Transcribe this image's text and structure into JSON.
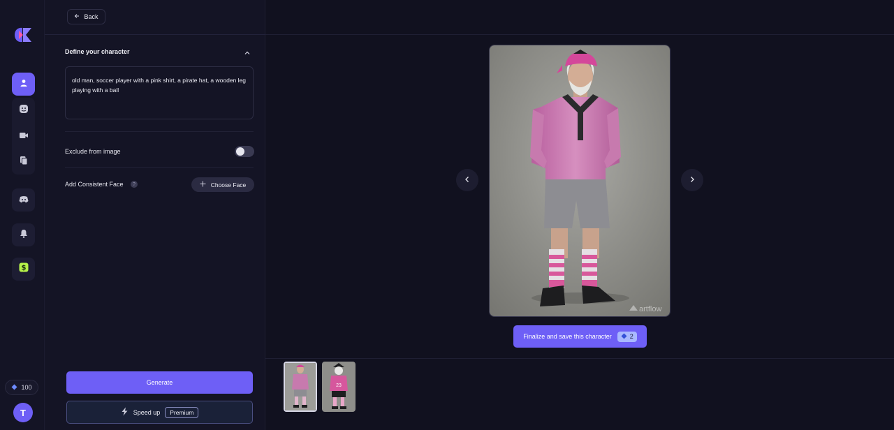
{
  "rail": {
    "items": [
      {
        "icon": "user-icon",
        "active": true
      },
      {
        "icon": "emoji-icon",
        "active": false
      },
      {
        "icon": "video-icon",
        "active": false
      },
      {
        "icon": "copy-icon",
        "active": false
      },
      {
        "icon": "discord-icon",
        "active": false
      },
      {
        "icon": "bell-icon",
        "active": false
      },
      {
        "icon": "dollar-icon",
        "active": false
      }
    ],
    "credits": "100",
    "avatar_initial": "T"
  },
  "panel": {
    "back_label": "Back",
    "section_title": "Define your character",
    "prompt_text": "old  man, soccer player with a pink shirt, a pirate hat, a wooden leg playing with a ball",
    "exclude_label": "Exclude from image",
    "exclude_enabled": false,
    "consistent_face_label": "Add Consistent Face",
    "choose_face_label": "Choose Face",
    "generate_label": "Generate",
    "speed_up_label": "Speed up",
    "premium_label": "Premium"
  },
  "main": {
    "watermark": "artflow",
    "finalize_label": "Finalize and save this character",
    "finalize_cost": "2",
    "thumbnails": [
      {
        "name": "thumbnail-1",
        "selected": true
      },
      {
        "name": "thumbnail-2",
        "selected": false
      }
    ]
  },
  "colors": {
    "accent": "#6e5ff6",
    "background": "#11111f",
    "panel": "#141425",
    "dollar_green": "#b6f24a"
  }
}
